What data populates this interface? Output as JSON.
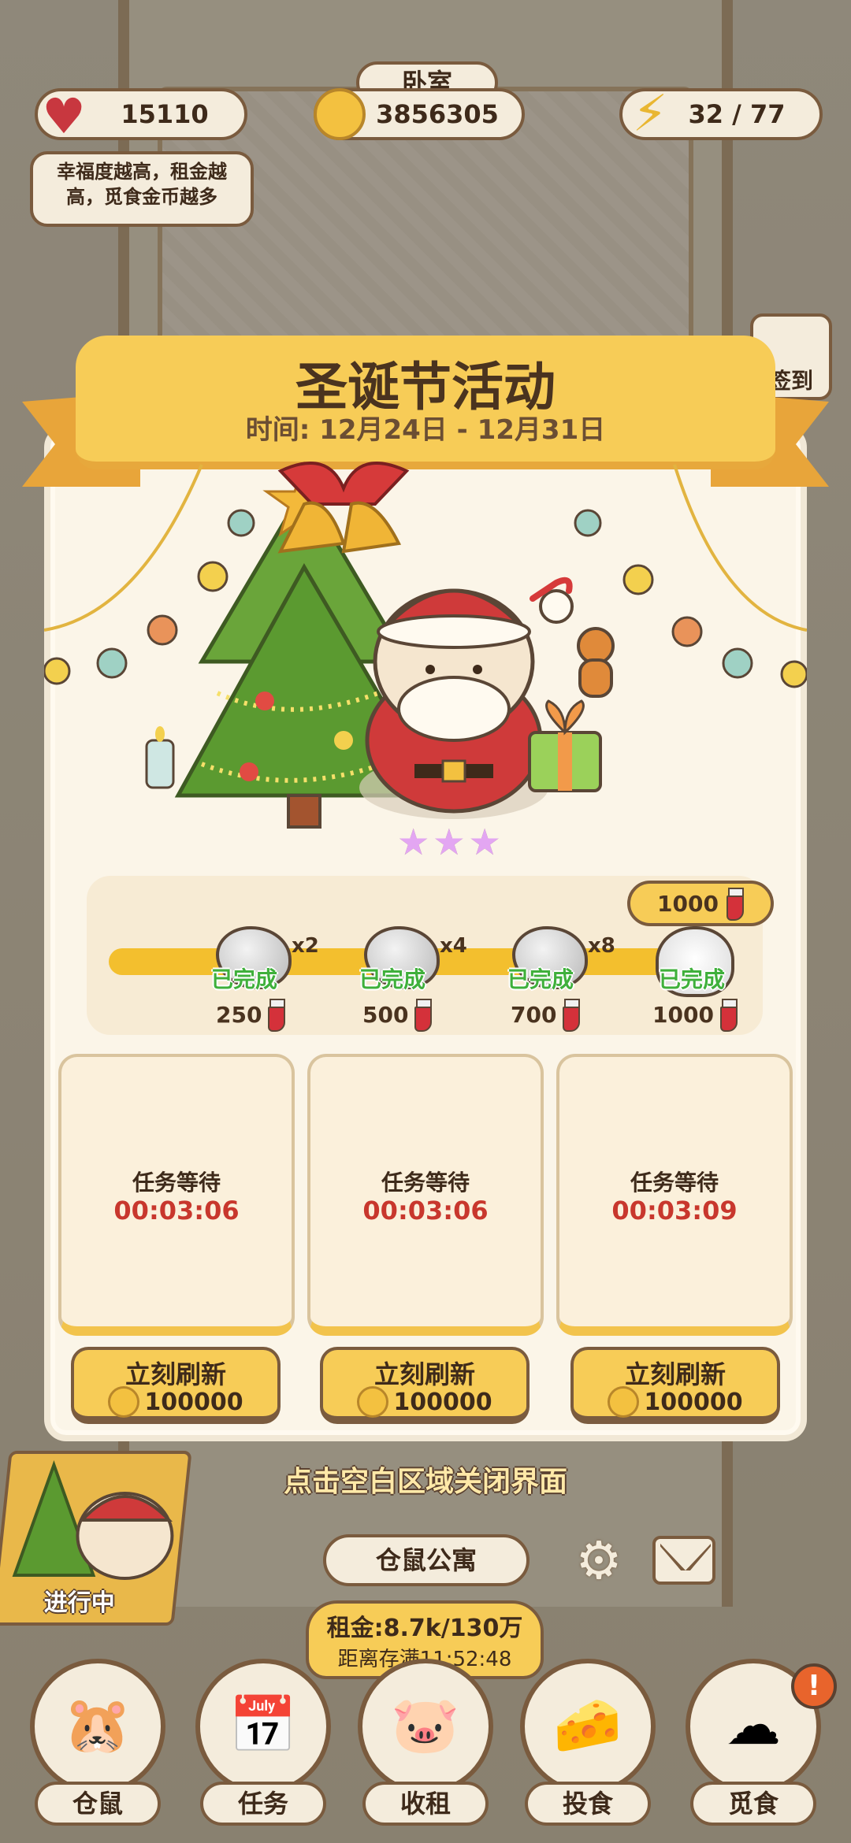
{
  "hud": {
    "happiness": "15110",
    "coins": "3856305",
    "energy": "32 / 77",
    "room_name": "卧室",
    "tip": "幸福度越高，租金越高，觅食金币越多",
    "checkin_label": "签到"
  },
  "event": {
    "title": "圣诞节活动",
    "time": "时间: 12月24日 - 12月31日",
    "stars": 3,
    "reward_bubble": "1000",
    "milestones": [
      {
        "status": "已完成",
        "multiplier": "x2",
        "cost": "250"
      },
      {
        "status": "已完成",
        "multiplier": "x4",
        "cost": "500"
      },
      {
        "status": "已完成",
        "multiplier": "x8",
        "cost": "700"
      },
      {
        "status": "已完成",
        "multiplier": "",
        "cost": "1000"
      }
    ],
    "tasks": [
      {
        "label": "任务等待",
        "timer": "00:03:06",
        "refresh_label": "立刻刷新",
        "refresh_cost": "100000"
      },
      {
        "label": "任务等待",
        "timer": "00:03:06",
        "refresh_label": "立刻刷新",
        "refresh_cost": "100000"
      },
      {
        "label": "任务等待",
        "timer": "00:03:09",
        "refresh_label": "立刻刷新",
        "refresh_cost": "100000"
      }
    ],
    "close_hint": "点击空白区域关闭界面"
  },
  "bottom": {
    "event_badge_status": "进行中",
    "apartment_name": "仓鼠公寓",
    "rent": "租金:8.7k/130万",
    "rent_full": "距离存满11:52:48",
    "alert": "!",
    "nav": [
      {
        "label": "仓鼠",
        "icon": "hamster-icon"
      },
      {
        "label": "任务",
        "icon": "calendar-icon"
      },
      {
        "label": "收租",
        "icon": "piggy-bank-icon"
      },
      {
        "label": "投食",
        "icon": "food-plate-icon"
      },
      {
        "label": "觅食",
        "icon": "cloud-hamster-icon"
      }
    ]
  },
  "colors": {
    "accent": "#f7cc57",
    "border": "#7a5b3e",
    "timer": "#c8372d",
    "done": "#3fb03b"
  }
}
